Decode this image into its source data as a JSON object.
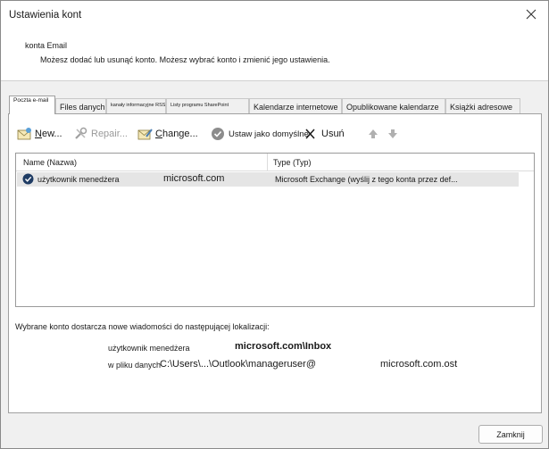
{
  "window": {
    "title": "Ustawienia kont"
  },
  "header": {
    "title": "konta Email",
    "description": "Możesz dodać lub usunąć konto. Możesz wybrać konto i zmienić jego ustawienia."
  },
  "tabs": [
    {
      "label": "Poczta e-mail",
      "active": true
    },
    {
      "label": "Files danych"
    },
    {
      "label": "kanały informacyjne RSS"
    },
    {
      "label": "Listy programu SharePoint"
    },
    {
      "label": "Kalendarze internetowe"
    },
    {
      "label": "Opublikowane kalendarze"
    },
    {
      "label": "Książki adresowe"
    }
  ],
  "toolbar": {
    "new_label": "New...",
    "repair_label": "Repair...",
    "change_label": "Change...",
    "default_label": "Ustaw jako domyślne",
    "remove_label": "Usuń"
  },
  "list": {
    "columns": [
      "Name (Nazwa)",
      "Type (Typ)"
    ],
    "rows": [
      {
        "name": "użytkownik menedżera",
        "domain": "microsoft.com",
        "type": "Microsoft Exchange (wyślij z tego konta przez def..."
      }
    ]
  },
  "delivery": {
    "label": "Wybrane konto dostarcza nowe wiadomości do następującej lokalizacji:",
    "account_name": "użytkownik menedżera",
    "inbox": "microsoft.com\\Inbox",
    "file_label": "w pliku danych",
    "file_path": "C:\\Users\\...\\Outlook\\manageruser@",
    "file_suffix": "microsoft.com.ost"
  },
  "buttons": {
    "close_label": "Zamknij"
  },
  "colors": {
    "window_bg": "#f0f0f0",
    "selected_row": "#e5e5e5",
    "border": "#a0a0a0"
  }
}
